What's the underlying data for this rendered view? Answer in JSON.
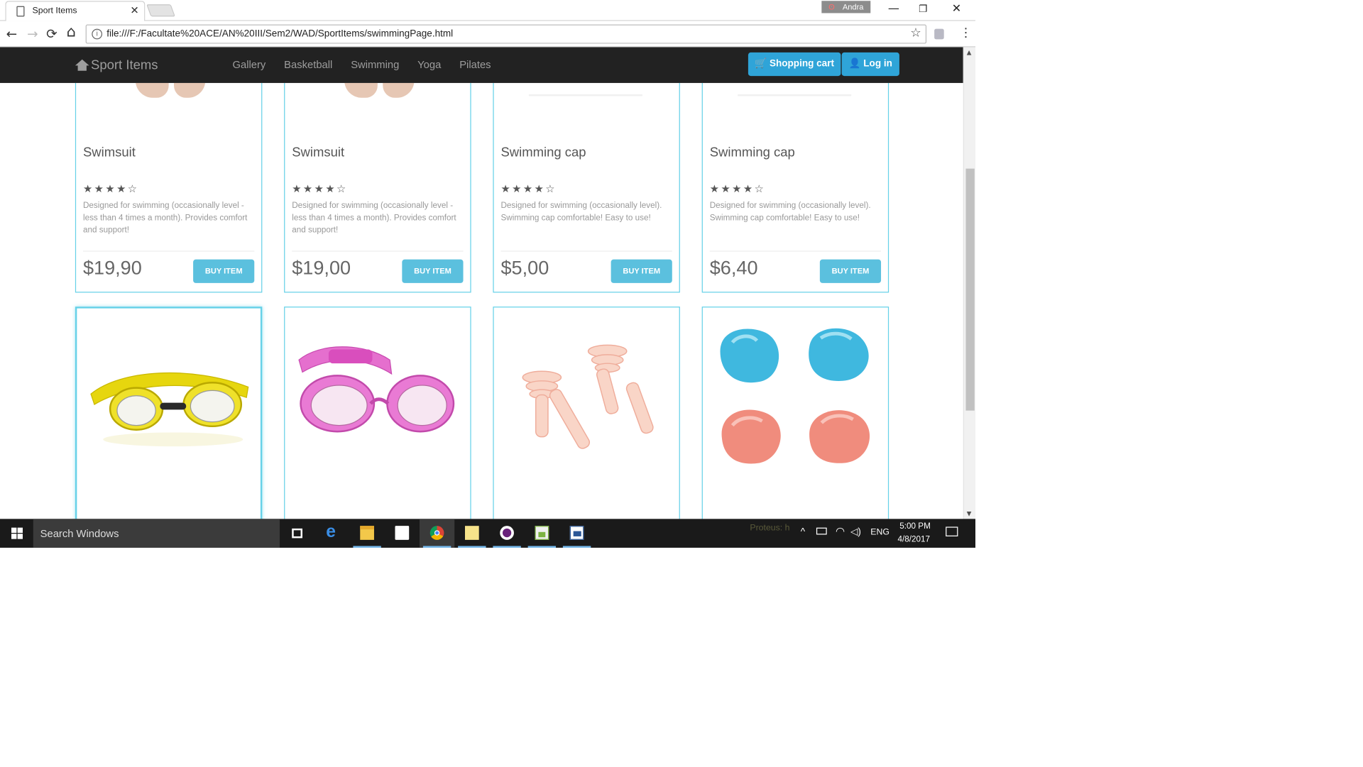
{
  "browser": {
    "tab_title": "Sport Items",
    "tab_close": "✕",
    "profile_name": "Andra",
    "window_controls": {
      "minimize": "—",
      "restore": "❐",
      "close": "✕"
    },
    "nav": {
      "back": "←",
      "forward": "→",
      "reload": "⟳",
      "home": "⌂"
    },
    "url": "file:///F:/Facultate%20ACE/AN%20III/Sem2/WAD/SportItems/swimmingPage.html",
    "info_glyph": "i",
    "bookmark_star": "☆",
    "menu_glyph": "⋮"
  },
  "site": {
    "brand": "Sport Items",
    "nav_links": [
      "Gallery",
      "Basketball",
      "Swimming",
      "Yoga",
      "Pilates"
    ],
    "cart_label": "🛒 Shopping cart",
    "login_label": "👤 Log in"
  },
  "products_row1": [
    {
      "name": "Swimsuit",
      "stars": "★★★★☆",
      "description": "Designed for swimming (occasionally level - less than 4 times a month). Provides comfort and support!",
      "price": "$19,90",
      "button": "BUY ITEM"
    },
    {
      "name": "Swimsuit",
      "stars": "★★★★☆",
      "description": "Designed for swimming (occasionally level - less than 4 times a month). Provides comfort and support!",
      "price": "$19,00",
      "button": "BUY ITEM"
    },
    {
      "name": "Swimming cap",
      "stars": "★★★★☆",
      "description": "Designed for swimming (occasionally level). Swimming cap comfortable! Easy to use!",
      "price": "$5,00",
      "button": "BUY ITEM"
    },
    {
      "name": "Swimming cap",
      "stars": "★★★★☆",
      "description": "Designed for swimming (occasionally level). Swimming cap comfortable! Easy to use!",
      "price": "$6,40",
      "button": "BUY ITEM"
    }
  ],
  "products_row2_images": [
    "yellow-goggles",
    "pink-goggles",
    "ear-plugs",
    "ear-plug-putty"
  ],
  "taskbar": {
    "search_placeholder": "Search Windows",
    "time": "5:00 PM",
    "date": "4/8/2017",
    "lang": "ENG",
    "notification_ghost": "Proteus: h"
  },
  "colors": {
    "navbar": "#222222",
    "accent": "#2fa4d8",
    "buy_button": "#5bc0de",
    "card_border": "#66d1e8"
  }
}
